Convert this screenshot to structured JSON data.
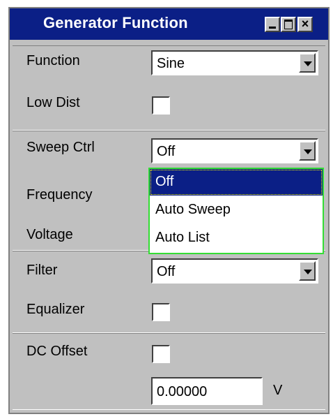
{
  "window": {
    "title": "Generator Function",
    "controls": {
      "minimize": "",
      "maximize": "",
      "close": "×"
    }
  },
  "rows": {
    "function": {
      "label": "Function",
      "value": "Sine"
    },
    "low_dist": {
      "label": "Low Dist",
      "checked": false
    },
    "sweep_ctrl": {
      "label": "Sweep Ctrl",
      "value": "Off"
    },
    "frequency": {
      "label": "Frequency"
    },
    "voltage": {
      "label": "Voltage"
    },
    "filter": {
      "label": "Filter",
      "value": "Off"
    },
    "equalizer": {
      "label": "Equalizer",
      "checked": false
    },
    "dc_offset": {
      "label": "DC Offset",
      "checked": false,
      "value": "0.00000",
      "unit": "V"
    }
  },
  "sweep_dropdown": {
    "options": [
      "Off",
      "Auto Sweep",
      "Auto List"
    ],
    "selected": "Off"
  },
  "colors": {
    "titlebar": "#0b1f86",
    "panel": "#c0c0c0",
    "dropdown_border": "#33dd33"
  }
}
